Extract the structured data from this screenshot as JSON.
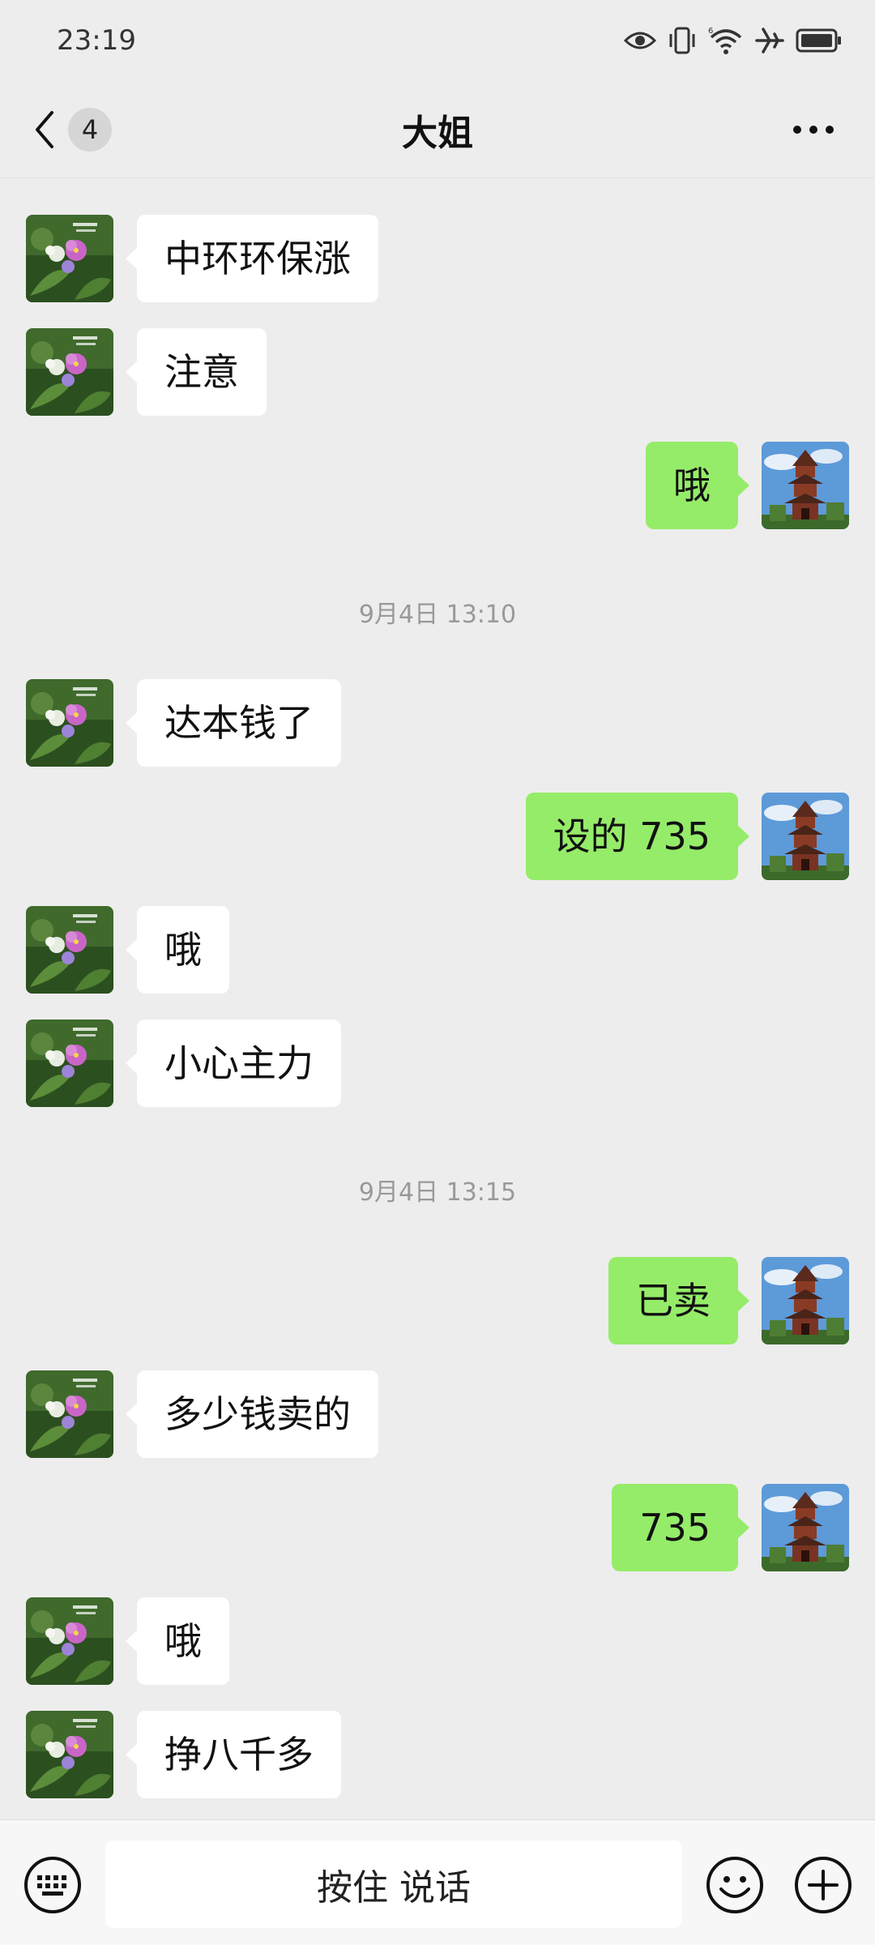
{
  "status_bar": {
    "time": "23:19"
  },
  "header": {
    "unread_count": "4",
    "title": "大姐"
  },
  "messages": {
    "m1": {
      "side": "left",
      "text": "中环环保涨"
    },
    "m2": {
      "side": "left",
      "text": "注意"
    },
    "m3": {
      "side": "right",
      "text": "哦"
    },
    "ts1": "9月4日 13:10",
    "m4": {
      "side": "left",
      "text": "达本钱了"
    },
    "m5": {
      "side": "right",
      "text": "设的 735"
    },
    "m6": {
      "side": "left",
      "text": "哦"
    },
    "m7": {
      "side": "left",
      "text": "小心主力"
    },
    "ts2": "9月4日 13:15",
    "m8": {
      "side": "right",
      "text": "已卖"
    },
    "m9": {
      "side": "left",
      "text": "多少钱卖的"
    },
    "m10": {
      "side": "right",
      "text": "735"
    },
    "m11": {
      "side": "left",
      "text": "哦"
    },
    "m12": {
      "side": "left",
      "text": "挣八千多"
    }
  },
  "input_bar": {
    "hold_to_talk": "按住 说话"
  },
  "icons": {
    "status": [
      "eye-icon",
      "vibrate-icon",
      "wifi-6-icon",
      "airplane-icon",
      "battery-icon"
    ],
    "header": [
      "back-chevron-icon",
      "more-dots-icon"
    ],
    "input": [
      "keyboard-icon",
      "emoji-icon",
      "plus-icon"
    ]
  },
  "colors": {
    "background": "#ededed",
    "sent_bubble": "#95ec69",
    "received_bubble": "#ffffff",
    "timestamp": "#999999"
  }
}
